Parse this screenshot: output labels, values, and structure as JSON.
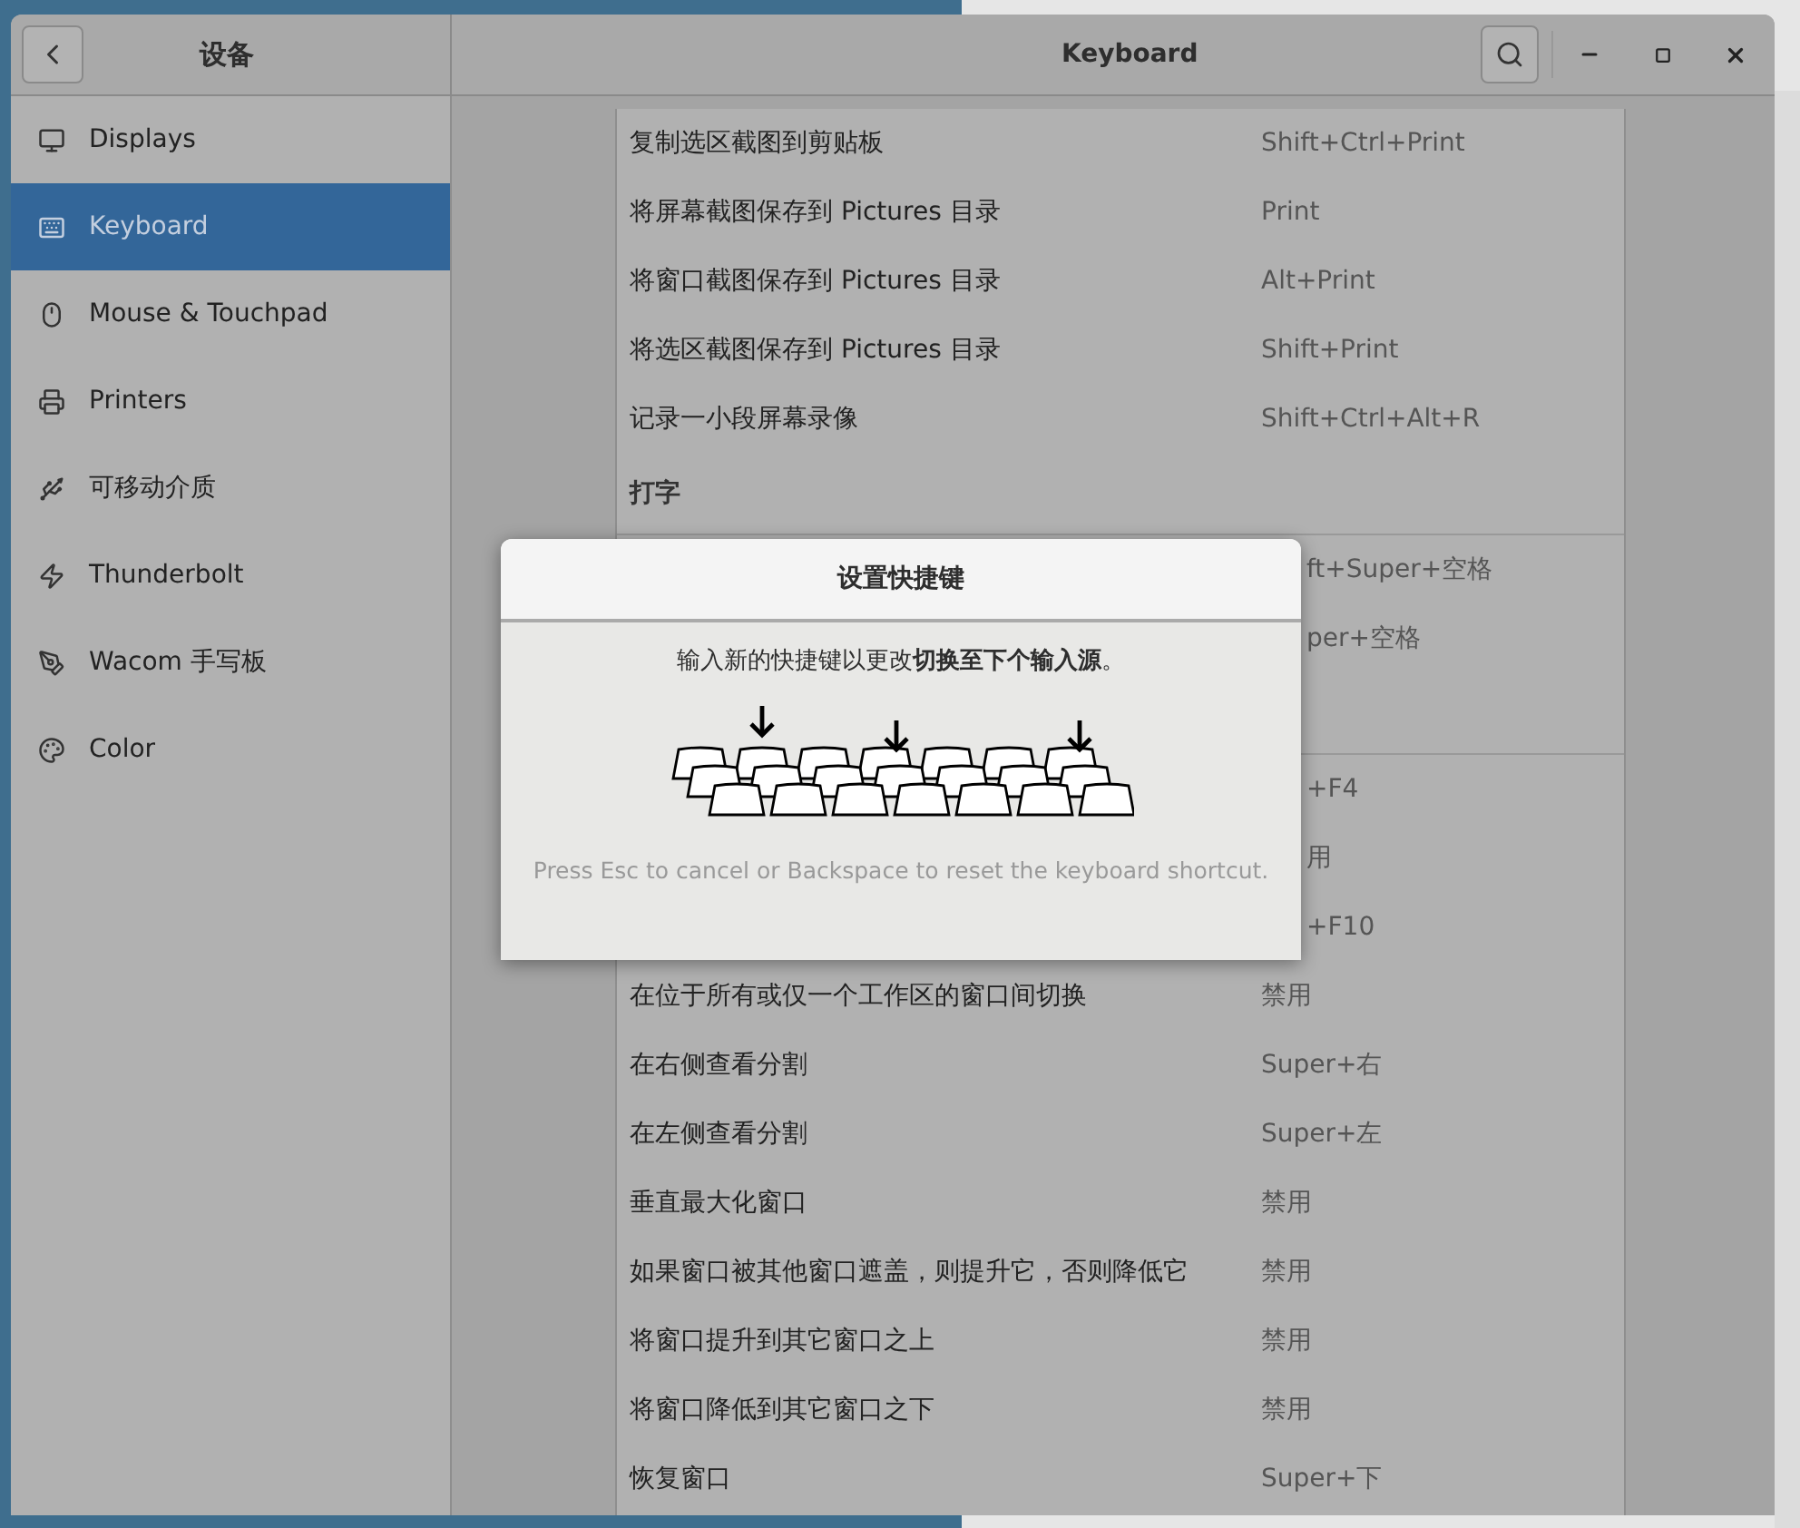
{
  "window": {
    "sidebar_title": "设备",
    "title": "Keyboard"
  },
  "sidebar": [
    {
      "label": "Displays",
      "selected": false
    },
    {
      "label": "Keyboard",
      "selected": true
    },
    {
      "label": "Mouse & Touchpad",
      "selected": false
    },
    {
      "label": "Printers",
      "selected": false
    },
    {
      "label": "可移动介质",
      "selected": false
    },
    {
      "label": "Thunderbolt",
      "selected": false
    },
    {
      "label": "Wacom 手写板",
      "selected": false
    },
    {
      "label": "Color",
      "selected": false
    }
  ],
  "sections": [
    {
      "rows": [
        {
          "kind": "row",
          "name": "复制选区截图到剪贴板",
          "shortcut": "Shift+Ctrl+Print"
        },
        {
          "kind": "row",
          "name": "将屏幕截图保存到 Pictures 目录",
          "shortcut": "Print"
        },
        {
          "kind": "row",
          "name": "将窗口截图保存到 Pictures 目录",
          "shortcut": "Alt+Print"
        },
        {
          "kind": "row",
          "name": "将选区截图保存到 Pictures 目录",
          "shortcut": "Shift+Print"
        },
        {
          "kind": "row",
          "name": "记录一小段屏幕录像",
          "shortcut": "Shift+Ctrl+Alt+R"
        }
      ]
    },
    {
      "title": "打字",
      "rows": [
        {
          "kind": "obscured",
          "shortcut": "ft+Super+空格"
        },
        {
          "kind": "obscured",
          "shortcut": "per+空格"
        }
      ]
    },
    {
      "rows": [
        {
          "kind": "obscured",
          "shortcut": "+F4"
        },
        {
          "kind": "obscured",
          "shortcut": "用"
        },
        {
          "kind": "obscured",
          "shortcut": "+F10"
        },
        {
          "kind": "row",
          "name": "在位于所有或仅一个工作区的窗口间切换",
          "shortcut": "禁用"
        },
        {
          "kind": "row",
          "name": "在右侧查看分割",
          "shortcut": "Super+右"
        },
        {
          "kind": "row",
          "name": "在左侧查看分割",
          "shortcut": "Super+左"
        },
        {
          "kind": "row",
          "name": "垂直最大化窗口",
          "shortcut": "禁用"
        },
        {
          "kind": "row",
          "name": "如果窗口被其他窗口遮盖，则提升它，否则降低它",
          "shortcut": "禁用"
        },
        {
          "kind": "row",
          "name": "将窗口提升到其它窗口之上",
          "shortcut": "禁用"
        },
        {
          "kind": "row",
          "name": "将窗口降低到其它窗口之下",
          "shortcut": "禁用"
        },
        {
          "kind": "row",
          "name": "恢复窗口",
          "shortcut": "Super+下"
        }
      ]
    }
  ],
  "dialog": {
    "title": "设置快捷键",
    "message": "输入新的快捷键以更改**切换至下个输入源**。",
    "hint": "Press Esc to cancel or Backspace to reset the keyboard shortcut."
  }
}
